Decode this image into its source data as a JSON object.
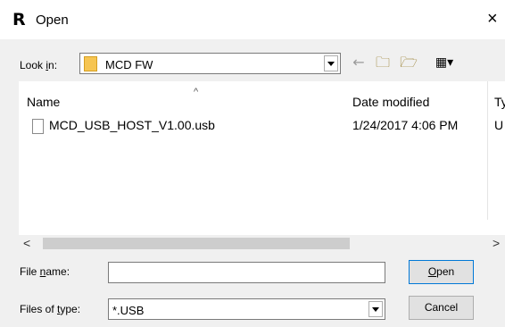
{
  "window": {
    "app_icon_letter": "R",
    "title": "Open",
    "close_glyph": "×"
  },
  "look_in": {
    "label_prefix": "Look ",
    "label_access": "i",
    "label_suffix": "n:",
    "value": "MCD FW",
    "folder_icon": "folder-icon"
  },
  "toolbar": {
    "back_icon": "←",
    "up_icon": "🗀",
    "new_folder_icon": "🗁",
    "view_icon": "▦▾"
  },
  "file_list": {
    "columns": [
      "Name",
      "Date modified",
      "Ty"
    ],
    "sort_indicator": "^",
    "files": [
      {
        "name": "MCD_USB_HOST_V1.00.usb",
        "date_modified": "1/24/2017 4:06 PM",
        "type": "U"
      }
    ],
    "scroll_left": "<",
    "scroll_right": ">"
  },
  "file_name": {
    "label_prefix": "File ",
    "label_access": "n",
    "label_suffix": "ame:",
    "value": ""
  },
  "files_of_type": {
    "label_prefix": "Files of ",
    "label_access": "t",
    "label_suffix": "ype:",
    "value": "*.USB"
  },
  "buttons": {
    "open_access": "O",
    "open_rest": "pen",
    "cancel": "Cancel"
  }
}
